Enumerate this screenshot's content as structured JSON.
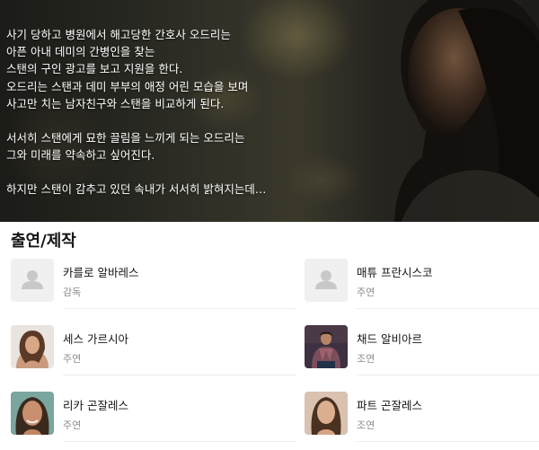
{
  "synopsis": {
    "lines": [
      "사기 당하고 병원에서 해고당한 간호사 오드리는",
      "아픈 아내 데미의 간병인을 찾는",
      "스탠의 구인 광고를 보고 지원을 한다.",
      "오드리는 스탠과 데미 부부의 애정 어린 모습을 보며",
      "사고만 치는 남자친구와 스탠을 비교하게 된다.",
      "",
      "서서히 스탠에게 묘한 끌림을 느끼게 되는 오드리는",
      "그와 미래를 약속하고 싶어진다.",
      "",
      "하지만 스탠이 감추고 있던 속내가 서서히 밝혀지는데…"
    ]
  },
  "credits": {
    "title": "출연/제작",
    "people": [
      {
        "name": "카를로 알바레스",
        "role": "감독",
        "avatar": "placeholder-person-icon"
      },
      {
        "name": "매튜 프란시스코",
        "role": "주연",
        "avatar": "placeholder-person-icon"
      },
      {
        "name": "세스 가르시아",
        "role": "주연",
        "avatar": "photo"
      },
      {
        "name": "채드 알비아르",
        "role": "조연",
        "avatar": "photo"
      },
      {
        "name": "리카 곤잘레스",
        "role": "주연",
        "avatar": "photo"
      },
      {
        "name": "파트 곤잘레스",
        "role": "조연",
        "avatar": "photo"
      }
    ]
  },
  "colors": {
    "text_primary": "#141414",
    "text_secondary": "#8c8c8c",
    "placeholder_bg": "#f0f0f0",
    "placeholder_icon": "#c8c8c8"
  }
}
